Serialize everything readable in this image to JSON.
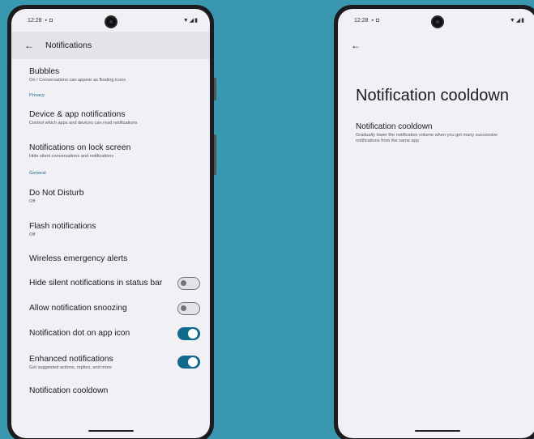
{
  "left_screen": {
    "status": {
      "time": "12:28",
      "icons": [
        "sim-icon",
        "message-icon",
        "wifi-icon",
        "signal-icon",
        "battery-icon"
      ]
    },
    "app_bar": {
      "back": "←",
      "title": "Notifications"
    },
    "rows": {
      "bubbles": {
        "title": "Bubbles",
        "sub": "On / Conversations can appear as floating icons"
      },
      "section_privacy": "Privacy",
      "device_app": {
        "title": "Device & app notifications",
        "sub": "Control which apps and devices can read notifications"
      },
      "lock_screen": {
        "title": "Notifications on lock screen",
        "sub": "Hide silent conversations and notifications"
      },
      "section_general": "General",
      "dnd": {
        "title": "Do Not Disturb",
        "sub": "Off"
      },
      "flash": {
        "title": "Flash notifications",
        "sub": "Off"
      },
      "emergency": {
        "title": "Wireless emergency alerts"
      },
      "hide_silent": {
        "title": "Hide silent notifications in status bar",
        "state": "off"
      },
      "snoozing": {
        "title": "Allow notification snoozing",
        "state": "off"
      },
      "dot": {
        "title": "Notification dot on app icon",
        "state": "on"
      },
      "enhanced": {
        "title": "Enhanced notifications",
        "sub": "Get suggested actions, replies, and more",
        "state": "on"
      },
      "cooldown": {
        "title": "Notification cooldown"
      }
    }
  },
  "right_screen": {
    "status": {
      "time": "12:28"
    },
    "app_bar": {
      "back": "←"
    },
    "page_title": "Notification cooldown",
    "item": {
      "title": "Notification cooldown",
      "sub": "Gradually lower the notification volume when you get many successive notifications from the same app"
    }
  },
  "colors": {
    "background": "#3a97b0",
    "accent": "#0f6a8c",
    "section_header": "#1f6a8a",
    "screen": "#f1f0f5"
  }
}
